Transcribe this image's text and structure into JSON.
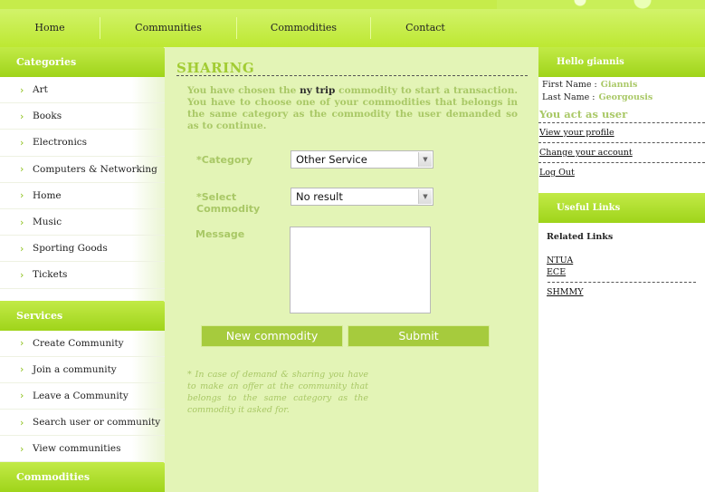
{
  "nav": {
    "items": [
      "Home",
      "Communities",
      "Commodities",
      "Contact"
    ]
  },
  "left": {
    "categories_title": "Categories",
    "categories": [
      "Art",
      "Books",
      "Electronics",
      "Computers & Networking",
      "Home",
      "Music",
      "Sporting Goods",
      "Tickets"
    ],
    "services_title": "Services",
    "services": [
      "Create Community",
      "Join a community",
      "Leave a Community",
      "Search user or community",
      "View communities"
    ],
    "commodities_title": "Commodities"
  },
  "main": {
    "title": "SHARING",
    "intro_prefix": "You have chosen the ",
    "intro_commodity": "ny trip",
    "intro_suffix": " commodity to start a transaction. You have to choose one of your commodities that belongs in the same category as the commodity the user demanded so as to continue.",
    "category_label": "*Category",
    "category_value": "Other Service",
    "select_label": "*Select Commodity",
    "select_value": "No result",
    "message_label": "Message",
    "new_commodity_label": "New commodity",
    "submit_label": "Submit",
    "note": "* In case of demand & sharing you have to make an offer at the community that belongs to the same category as the commodity it asked for."
  },
  "right": {
    "hello": "Hello giannis",
    "first_name_label": "First Name :",
    "first_name": "Giannis",
    "last_name_label": "Last Name :",
    "last_name": "Georgousis",
    "act_as": "You act as user",
    "links": [
      "View your profile",
      "Change your account",
      "Log Out"
    ],
    "useful_title": "Useful Links",
    "related_title": "Related Links",
    "related_links": [
      "NTUA",
      "ECE"
    ],
    "extra_link": "SHMMY"
  },
  "colors": {
    "accent": "#a9c866",
    "header_green": "#a6d321",
    "panel": "#e3f4b6"
  }
}
